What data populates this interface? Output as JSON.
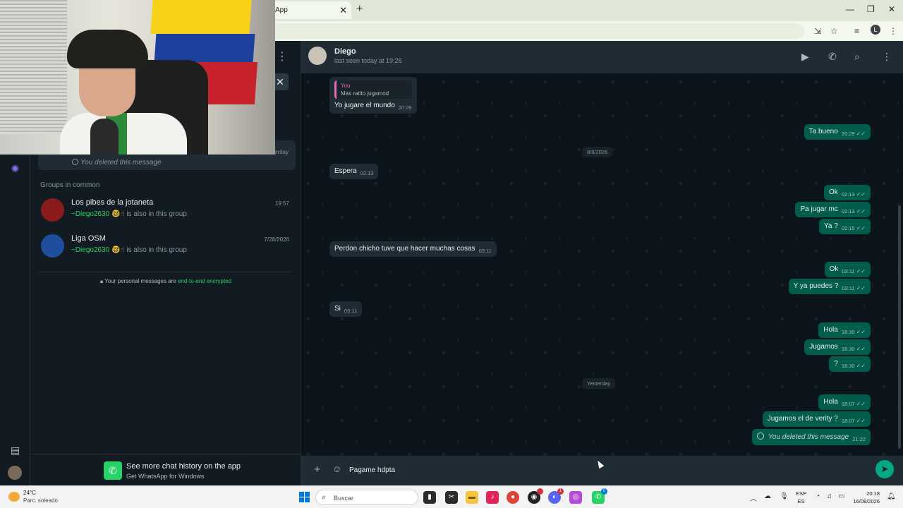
{
  "browser": {
    "tab_title": "App",
    "tab_close": "✕",
    "new_tab": "+",
    "window_controls": [
      "—",
      "❐",
      "✕"
    ],
    "profile_initial": "L"
  },
  "sidebar_panel": {
    "chat_preview": {
      "time": "erday",
      "text": "You deleted this message"
    },
    "groups_title": "Groups in common",
    "groups": [
      {
        "name": "Los pibes de la jotaneta",
        "time": "19:57",
        "member": "~Diego2630",
        "member_emoji": "🤓☝",
        "suffix": "is also in this group",
        "avatar_color": "#8b1a1a"
      },
      {
        "name": "Liga OSM",
        "time": "7/28/2026",
        "member": "~Diego2630",
        "member_emoji": "🤓☝",
        "suffix": "is also in this group",
        "avatar_color": "#1f4e9c"
      }
    ],
    "encryption": {
      "prefix": "Your personal messages are ",
      "link": "end-to-end encrypted"
    },
    "promo": {
      "title": "See more chat history on the app",
      "subtitle": "Get WhatsApp for Windows"
    }
  },
  "chat": {
    "contact_name": "Diego",
    "status": "last seen today at 19:26",
    "header_icons": [
      "video-icon",
      "phone-icon",
      "search-icon",
      "menu-icon"
    ],
    "quote": {
      "author": "You",
      "text": "Mas ratito jugamod"
    },
    "messages": [
      {
        "dir": "in",
        "text": "Yo jugare el mundo",
        "time": "20:28"
      },
      {
        "dir": "out",
        "text": "Ta bueno",
        "time": "20:29"
      },
      {
        "dir": "in",
        "text": "Espera",
        "time": "02:13"
      },
      {
        "dir": "out",
        "text": "Ok",
        "time": "02:13"
      },
      {
        "dir": "out",
        "text": "Pa jugar mc",
        "time": "02:13"
      },
      {
        "dir": "out",
        "text": "Ya ?",
        "time": "02:15"
      },
      {
        "dir": "in",
        "text": "Perdon chicho tuve que hacer muchas cosas",
        "time": "03:11"
      },
      {
        "dir": "out",
        "text": "Ok",
        "time": "03:11"
      },
      {
        "dir": "out",
        "text": "Y ya puedes ?",
        "time": "03:11"
      },
      {
        "dir": "in",
        "text": "Si",
        "time": "03:11"
      },
      {
        "dir": "out",
        "text": "Hola",
        "time": "18:30"
      },
      {
        "dir": "out",
        "text": "Jugamos",
        "time": "18:30"
      },
      {
        "dir": "out",
        "text": "?",
        "time": "18:30"
      },
      {
        "dir": "out",
        "text": "Hola",
        "time": "18:07"
      },
      {
        "dir": "out",
        "text": "Jugamos el de verity ?",
        "time": "18:07"
      },
      {
        "dir": "out",
        "text": "You deleted this message",
        "time": "21:22",
        "deleted": true
      }
    ],
    "date_chips": [
      "8/8/2026",
      "Yesterday"
    ],
    "composer_text": "Pagame hdpta"
  },
  "taskbar": {
    "temperature": "24°C",
    "condition": "Parc. soleado",
    "search_placeholder": "Buscar",
    "lang_line1": "ESP",
    "lang_line2": "ES",
    "time": "20:18",
    "date": "16/08/2026",
    "badges": [
      "1",
      "0"
    ]
  },
  "colors": {
    "outgoing_bubble": "#005c4b",
    "incoming_bubble": "#202c33",
    "accent": "#25d366",
    "background": "#0b141a"
  }
}
